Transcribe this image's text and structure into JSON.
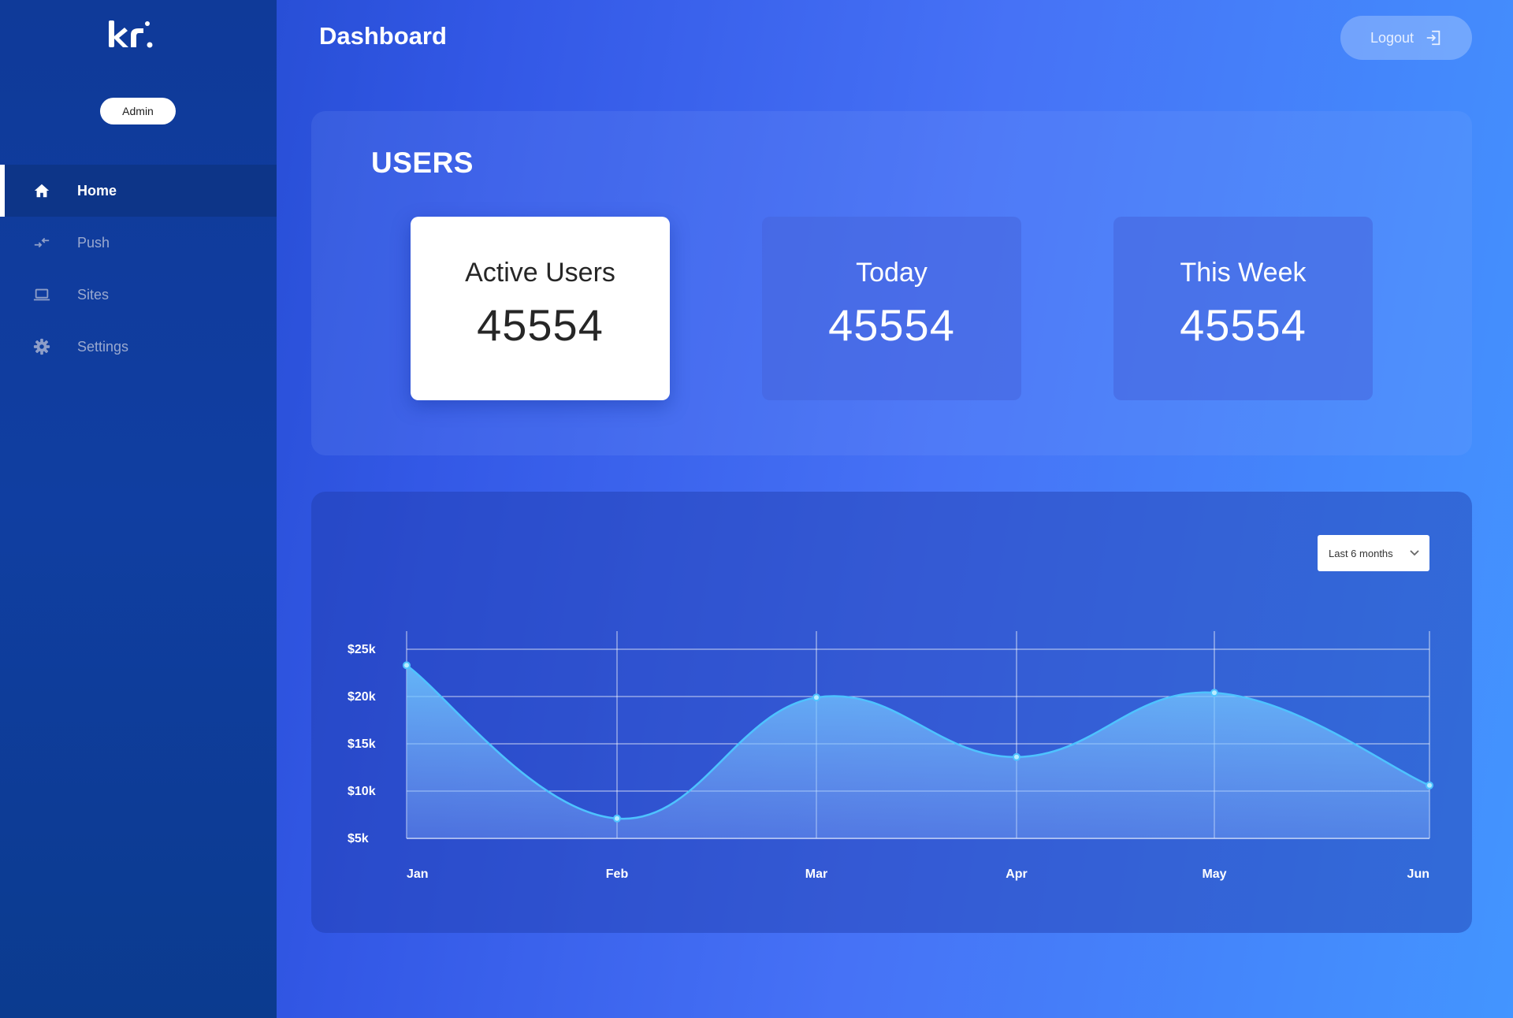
{
  "sidebar": {
    "logo_text": "kr",
    "role": "Admin",
    "items": [
      {
        "label": "Home",
        "icon": "home-icon"
      },
      {
        "label": "Push",
        "icon": "push-arrows-icon"
      },
      {
        "label": "Sites",
        "icon": "laptop-icon"
      },
      {
        "label": "Settings",
        "icon": "gear-icon"
      }
    ],
    "active_index": 0
  },
  "header": {
    "title": "Dashboard",
    "logout_label": "Logout"
  },
  "users": {
    "title": "USERS",
    "cards": [
      {
        "label": "Active Users",
        "value": "45554"
      },
      {
        "label": "Today",
        "value": "45554"
      },
      {
        "label": "This Week",
        "value": "45554"
      }
    ]
  },
  "chart_controls": {
    "range_label": "Last 6 months"
  },
  "colors": {
    "accent": "#4ec3ff",
    "sidebar_active": "#0d3588"
  },
  "chart_data": {
    "type": "area",
    "categories": [
      "Jan",
      "Feb",
      "Mar",
      "Apr",
      "May",
      "Jun"
    ],
    "values": [
      23300,
      7100,
      19900,
      13600,
      20400,
      10600
    ],
    "yticks": [
      "$5k",
      "$10k",
      "$15k",
      "$20k",
      "$25k"
    ],
    "ytick_values": [
      5000,
      10000,
      15000,
      20000,
      25000
    ],
    "ylim": [
      5000,
      25000
    ],
    "grid": true,
    "xlabel": "",
    "ylabel": ""
  }
}
